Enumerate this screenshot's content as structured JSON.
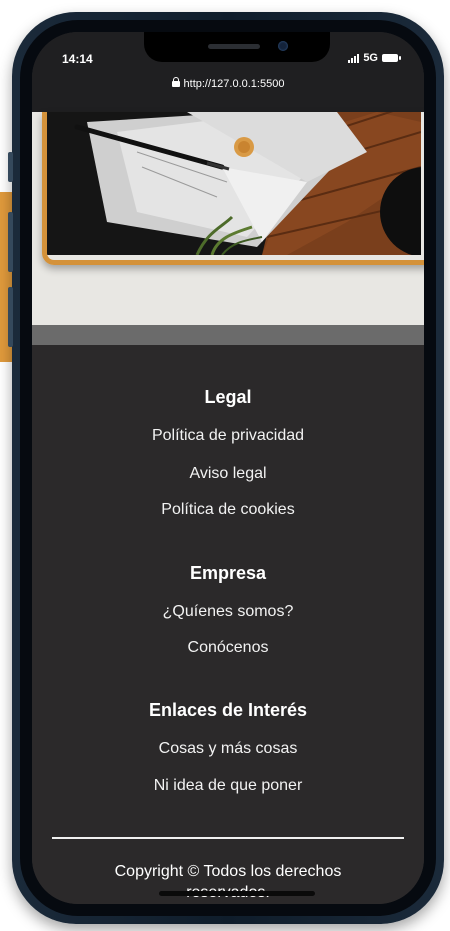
{
  "status_bar": {
    "time": "14:14",
    "network": "5G"
  },
  "browser": {
    "url": "http://127.0.0.1:5500"
  },
  "footer": {
    "sections": [
      {
        "title": "Legal",
        "links": [
          "Política de privacidad",
          "Aviso legal",
          "Política de cookies"
        ]
      },
      {
        "title": "Empresa",
        "links": [
          "¿Quíenes somos?",
          "Conócenos"
        ]
      },
      {
        "title": "Enlaces de Interés",
        "links": [
          "Cosas y más cosas",
          "Ni idea de que poner"
        ]
      }
    ],
    "copyright": "Copyright © Todos los derechos reservados."
  },
  "colors": {
    "footer_bg": "#2b292a",
    "accent_orange": "#d4923a",
    "band_gray": "#6b6b6b",
    "hero_bg": "#e8e7e3"
  },
  "icons": [
    "lock-icon",
    "signal-icon",
    "battery-icon"
  ]
}
